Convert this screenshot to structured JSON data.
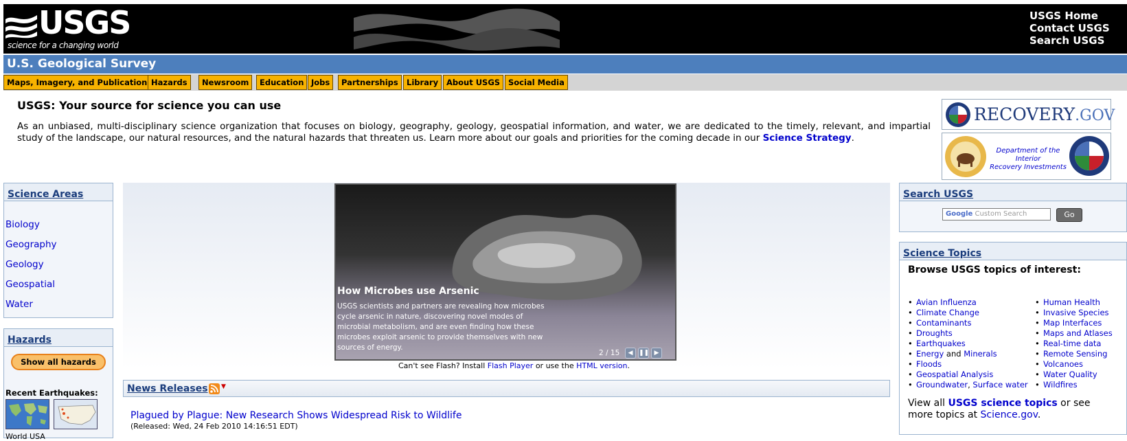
{
  "header": {
    "logo_name": "USGS",
    "logo_tagline": "science for a changing world",
    "links": [
      "USGS Home",
      "Contact USGS",
      "Search USGS"
    ]
  },
  "title_bar": "U.S. Geological Survey",
  "nav": [
    "Maps, Imagery, and Publications",
    "Hazards",
    "Newsroom",
    "Education",
    "Jobs",
    "Partnerships",
    "Library",
    "About USGS",
    "Social Media"
  ],
  "intro": {
    "title": "USGS: Your source for science you can use",
    "text": "As an unbiased, multi-disciplinary science organization that focuses on biology, geography, geology, geospatial information, and water, we are dedicated to the timely, relevant, and impartial study of the landscape, our natural resources, and the natural hazards that threaten us. Learn more about our goals and priorities for the coming decade in our ",
    "link": "Science Strategy",
    "end": "."
  },
  "recovery": {
    "main": "RECOVERY",
    "gov": ".GOV",
    "doi_text_1": "Department of the Interior",
    "doi_text_2": "Recovery Investments"
  },
  "science_areas": {
    "title": "Science Areas",
    "items": [
      "Biology",
      "Geography",
      "Geology",
      "Geospatial",
      "Water"
    ]
  },
  "hazards": {
    "title": "Hazards",
    "button": "Show all hazards",
    "recent": "Recent Earthquakes:",
    "links": "World USA"
  },
  "slideshow": {
    "title": "How Microbes use Arsenic",
    "desc": "USGS scientists and partners are revealing how microbes cycle arsenic in nature, discovering novel modes of microbial metabolism, and are even finding how these microbes exploit arsenic to provide themselves with new sources of energy.",
    "counter": "2 / 15",
    "flash_pre": "Can't see Flash? Install ",
    "flash_link": "Flash Player",
    "flash_mid": " or use the ",
    "html_link": "HTML version",
    "flash_end": "."
  },
  "news": {
    "title": "News Releases",
    "items": [
      {
        "headline": "Plagued by Plague: New Research Shows Widespread Risk to Wildlife",
        "date": "(Released: Wed, 24 Feb 2010 14:16:51 EDT)"
      }
    ]
  },
  "search": {
    "title": "Search USGS",
    "google": "Google",
    "placeholder": " Custom Search",
    "button": "Go"
  },
  "topics": {
    "title": "Science Topics",
    "browse": "Browse USGS topics of interest:",
    "col1": [
      "Avian Influenza",
      "Climate Change",
      "Contaminants",
      "Droughts",
      "Earthquakes",
      "Energy",
      "Floods",
      "Geospatial Analysis",
      "Groundwater"
    ],
    "and_word": "and",
    "minerals": "Minerals",
    "surface_water": "Surface water",
    "col2": [
      "Human Health",
      "Invasive Species",
      "Map Interfaces",
      "Maps and Atlases",
      "Real-time data",
      "Remote Sensing",
      "Volcanoes",
      "Water Quality",
      "Wildfires"
    ],
    "view_pre": "View all ",
    "view_link": "USGS science topics",
    "view_mid": " or see more topics at ",
    "gov_link": "Science.gov",
    "view_end": "."
  },
  "colors": {
    "title_bar": "#4d7fbd",
    "nav_tab": "#f7b200",
    "link": "#0000cc"
  }
}
